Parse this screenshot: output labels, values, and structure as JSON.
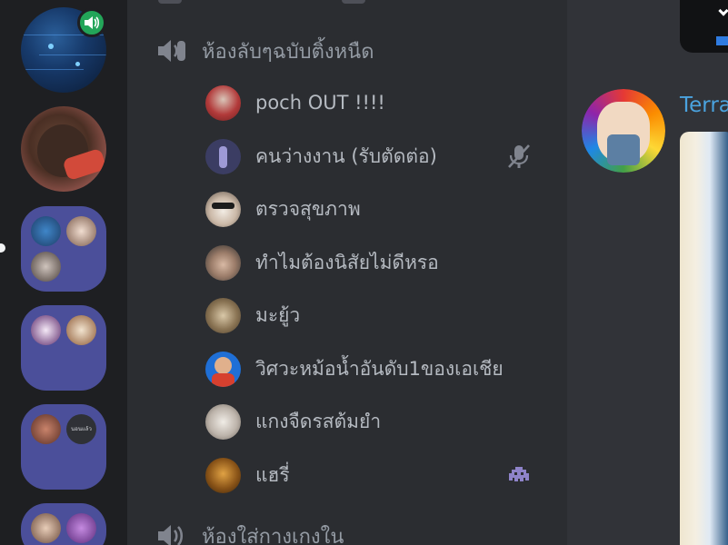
{
  "servers": {
    "active_server_speaking_icon": "speaker-icon",
    "folders": [
      {
        "unread": true
      },
      {
        "unread": false
      },
      {
        "unread": false,
        "mini_label": "นอนแล้ว"
      },
      {
        "unread": false
      }
    ]
  },
  "voice_channels": [
    {
      "name": "ห้องลับๆฉบับติ้งหนืด",
      "icon": "speaker-icon"
    },
    {
      "name": "ห้องใส่กางเกงใน",
      "icon": "speaker-icon"
    }
  ],
  "voice_users": [
    {
      "name": "poch OUT !!!!",
      "indicator": null
    },
    {
      "name": "คนว่างงาน (รับตัดต่อ)",
      "indicator": "muted-mic-icon"
    },
    {
      "name": "ตรวจสุขภาพ",
      "indicator": null
    },
    {
      "name": "ทำไมต้องนิสัยไม่ดีหรอ",
      "indicator": null
    },
    {
      "name": "มะยู้ว",
      "indicator": null
    },
    {
      "name": "วิศวะหม้อน้ำอันดับ1ของเอเชีย",
      "indicator": null
    },
    {
      "name": "แกงจืดรสต้มยำ",
      "indicator": null
    },
    {
      "name": "แฮรี่",
      "indicator": "activity-invader-icon"
    }
  ],
  "chat": {
    "author_visible": "Terra"
  },
  "colors": {
    "server_rail": "#1e1f22",
    "channel_bg": "#2b2d31",
    "chat_bg": "#313338",
    "folder": "#4b4f9a",
    "speaking_green": "#23a559",
    "author_blue": "#4aa3df"
  }
}
